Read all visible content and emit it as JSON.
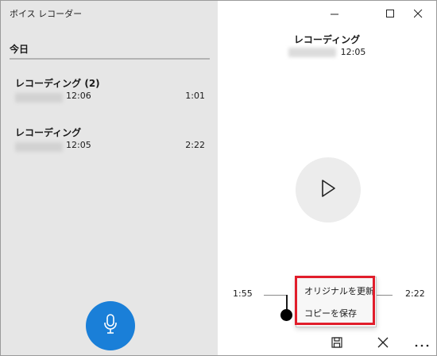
{
  "app": {
    "title": "ボイス レコーダー"
  },
  "left": {
    "section_header": "今日",
    "recordings": [
      {
        "name": "レコーディング (2)",
        "time": "12:06",
        "duration": "1:01"
      },
      {
        "name": "レコーディング",
        "time": "12:05",
        "duration": "2:22"
      }
    ]
  },
  "detail": {
    "title": "レコーディング",
    "time": "12:05",
    "current_time": "1:55",
    "total_time": "2:22"
  },
  "context_menu": {
    "items": [
      "オリジナルを更新",
      "コピーを保存"
    ]
  },
  "colors": {
    "accent": "#1a7fd8",
    "highlight": "#e11d2b",
    "left_bg": "#e6e6e6"
  },
  "icons": {
    "mic": "microphone-icon",
    "play": "play-icon",
    "save": "save-icon",
    "trim": "trim-icon",
    "more": "more-icon"
  }
}
